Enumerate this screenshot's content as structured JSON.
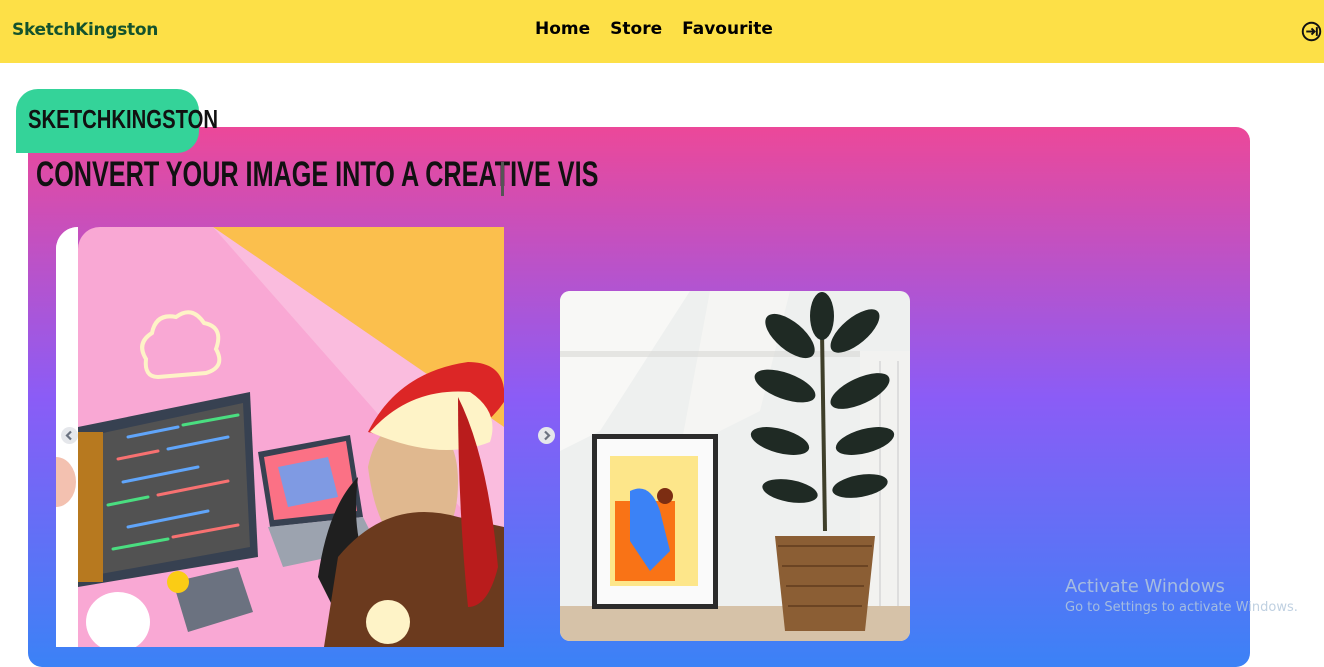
{
  "brand": "SketchKingston",
  "nav": {
    "links": [
      "Home",
      "Store",
      "Favourite"
    ],
    "login_icon": "login-icon"
  },
  "hero": {
    "badge": "SKETCHKINGSTON",
    "headline": "CONVERT YOUR IMAGE INTO A CREATIVE VIS"
  },
  "colors": {
    "navbar": "#fde047",
    "badge": "#34d399",
    "gradient_top": "#ec4899",
    "gradient_mid": "#8b5cf6",
    "gradient_bottom": "#3b82f6"
  },
  "watermark": {
    "title": "Activate Windows",
    "subtitle": "Go to Settings to activate Windows."
  }
}
